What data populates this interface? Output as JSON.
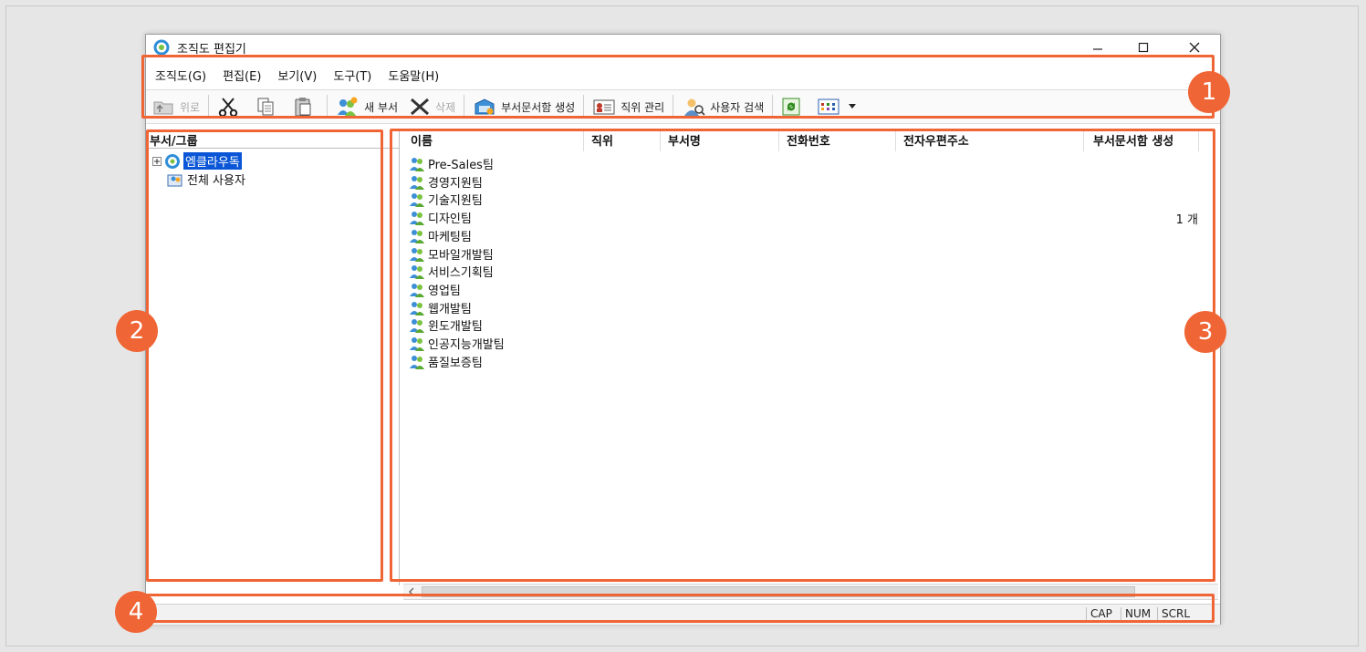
{
  "window": {
    "title": "조직도 편집기"
  },
  "menu": [
    "조직도(G)",
    "편집(E)",
    "보기(V)",
    "도구(T)",
    "도움말(H)"
  ],
  "toolbar": {
    "up_label": "위로",
    "new_dept_label": "새 부서",
    "delete_label": "삭제",
    "create_mailbox_label": "부서문서함 생성",
    "position_label": "직위 관리",
    "user_search_label": "사용자 검색"
  },
  "tree": {
    "header": "부서/그룹",
    "root": "엠클라우독",
    "all_users": "전체 사용자"
  },
  "list": {
    "columns": [
      "이름",
      "직위",
      "부서명",
      "전화번호",
      "전자우편주소",
      "부서문서함 생성"
    ],
    "rows": [
      {
        "name": "Pre-Sales팀",
        "count": ""
      },
      {
        "name": "경영지원팀",
        "count": ""
      },
      {
        "name": "기술지원팀",
        "count": ""
      },
      {
        "name": "디자인팀",
        "count": "1 개"
      },
      {
        "name": "마케팅팀",
        "count": ""
      },
      {
        "name": "모바일개발팀",
        "count": ""
      },
      {
        "name": "서비스기획팀",
        "count": ""
      },
      {
        "name": "영업팀",
        "count": ""
      },
      {
        "name": "웹개발팀",
        "count": ""
      },
      {
        "name": "윈도개발팀",
        "count": ""
      },
      {
        "name": "인공지능개발팀",
        "count": ""
      },
      {
        "name": "품질보증팀",
        "count": ""
      }
    ]
  },
  "status": {
    "cap": "CAP",
    "num": "NUM",
    "scrl": "SCRL"
  },
  "callouts": [
    "1",
    "2",
    "3",
    "4"
  ],
  "colors": {
    "accent": "#f06535",
    "selection": "#0a56d6"
  }
}
